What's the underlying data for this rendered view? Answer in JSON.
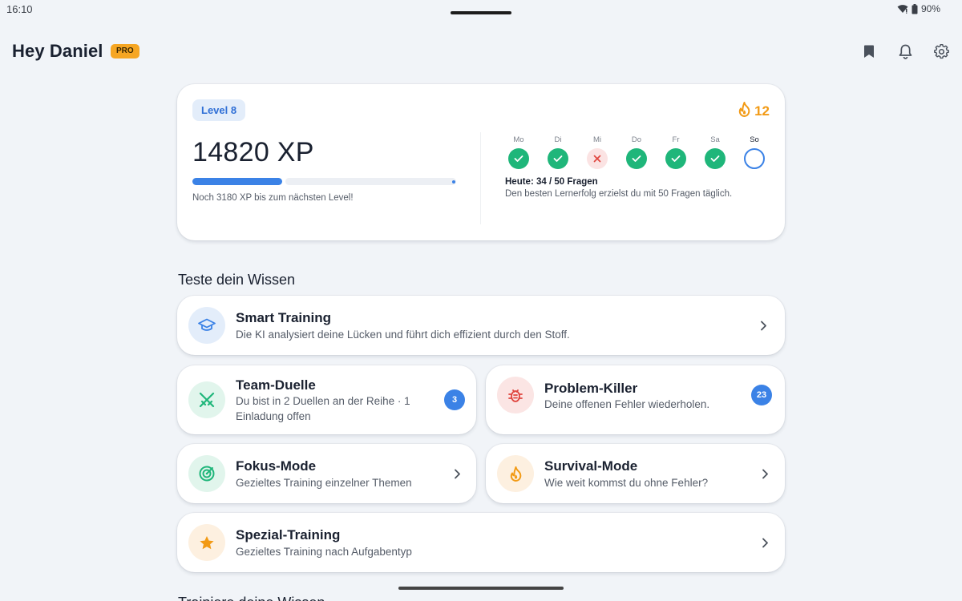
{
  "status": {
    "time": "16:10",
    "battery": "90%"
  },
  "header": {
    "greeting": "Hey Daniel",
    "badge": "PRO",
    "icons": [
      "bookmark-icon",
      "bell-icon",
      "gear-icon"
    ]
  },
  "level_card": {
    "level": "Level 8",
    "streak": "12",
    "xp": "14820 XP",
    "progress_fraction": 0.34,
    "xp_note": "Noch 3180 XP bis zum nächsten Level!",
    "days": [
      {
        "label": "Mo",
        "state": "done"
      },
      {
        "label": "Di",
        "state": "done"
      },
      {
        "label": "Mi",
        "state": "missed"
      },
      {
        "label": "Do",
        "state": "done"
      },
      {
        "label": "Fr",
        "state": "done"
      },
      {
        "label": "Sa",
        "state": "done"
      },
      {
        "label": "So",
        "state": "today"
      }
    ],
    "today_title": "Heute: 34 / 50 Fragen",
    "today_sub": "Den besten Lernerfolg erzielst du mit 50 Fragen täglich."
  },
  "section": {
    "title": "Teste dein Wissen",
    "next_title": "Trainiere deine Wissen"
  },
  "tiles": {
    "smart": {
      "title": "Smart Training",
      "sub": "Die KI analysiert deine Lücken und führt dich effizient durch den Stoff."
    },
    "duelle": {
      "title": "Team-Duelle",
      "sub": "Du bist in 2 Duellen an der Reihe · 1 Einladung offen",
      "badge": "3"
    },
    "problem": {
      "title": "Problem-Killer",
      "sub": "Deine offenen Fehler wiederholen.",
      "badge": "23"
    },
    "fokus": {
      "title": "Fokus-Mode",
      "sub": "Gezieltes Training einzelner Themen"
    },
    "survival": {
      "title": "Survival-Mode",
      "sub": "Wie weit kommst du ohne Fehler?"
    },
    "spezial": {
      "title": "Spezial-Training",
      "sub": "Gezieltes Training nach Aufgabentyp"
    }
  },
  "colors": {
    "accent": "#3b82e6",
    "success": "#1fb67a",
    "streak": "#f29a15",
    "pro": "#f6a623",
    "background": "#f1f4f8"
  }
}
